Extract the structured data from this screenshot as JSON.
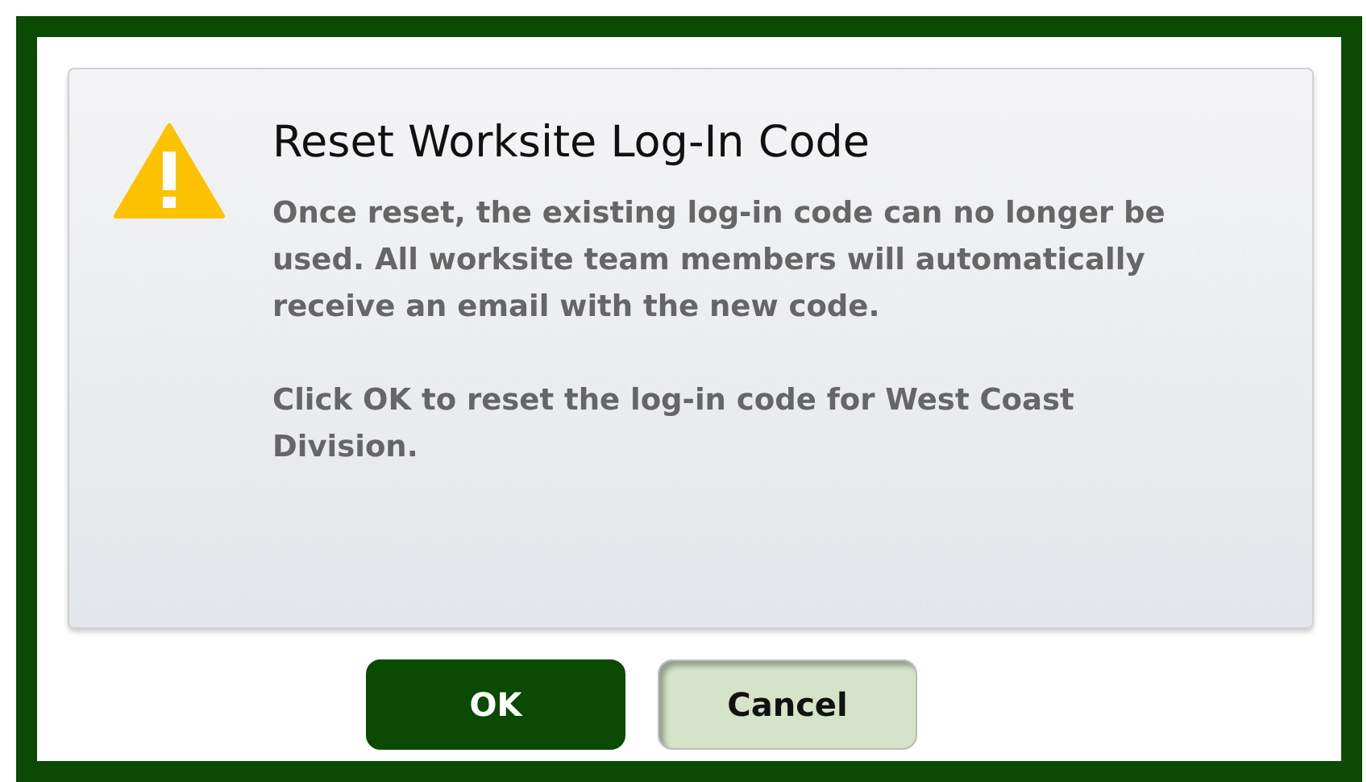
{
  "dialog": {
    "title": "Reset Worksite Log-In Code",
    "paragraphs": [
      "Once reset, the existing log-in code can no longer be used. All worksite team members will automatically receive an email with the new code.",
      "Click OK to reset the log-in code for West Coast Division."
    ],
    "buttons": [
      {
        "label": "OK",
        "kind": "primary"
      },
      {
        "label": "Cancel",
        "kind": "secondary"
      }
    ]
  }
}
